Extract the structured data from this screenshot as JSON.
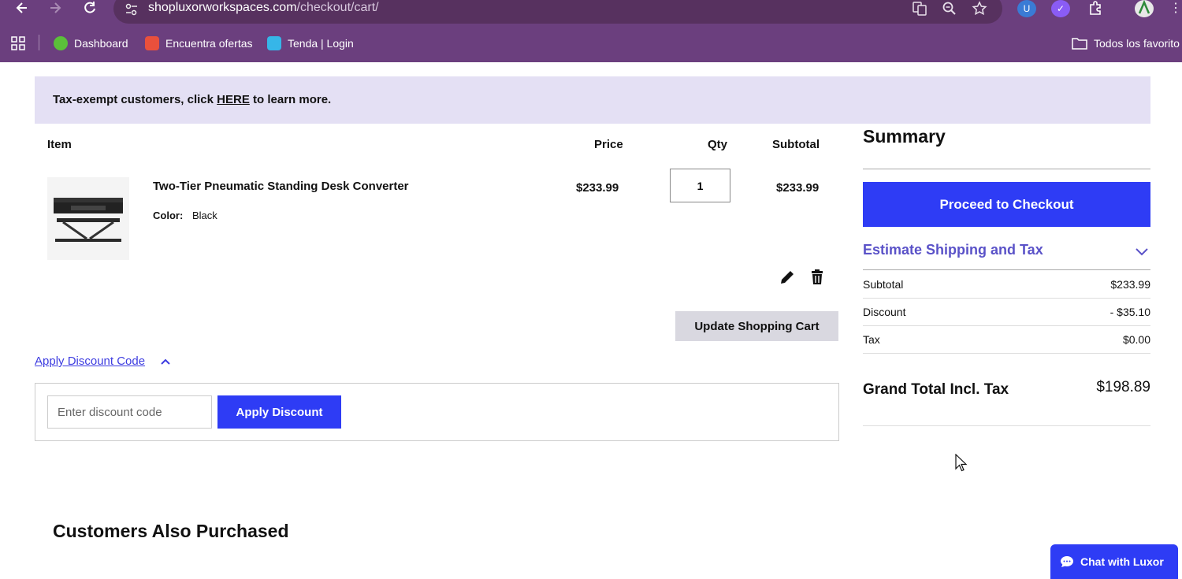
{
  "browser": {
    "url_host": "shopluxorworkspaces.com",
    "url_path": "/checkout/cart/",
    "bookmarks": [
      {
        "label": "Dashboard",
        "color": "#5bbf3a"
      },
      {
        "label": "Encuentra ofertas",
        "color": "#e9503c"
      },
      {
        "label": "Tenda | Login",
        "color": "#36b6e8"
      }
    ],
    "all_bookmarks_label": "Todos los favorito"
  },
  "banner": {
    "prefix": "Tax-exempt customers, click ",
    "link": "HERE",
    "suffix": " to learn more."
  },
  "cart": {
    "headers": {
      "item": "Item",
      "price": "Price",
      "qty": "Qty",
      "subtotal": "Subtotal"
    },
    "items": [
      {
        "name": "Two-Tier Pneumatic Standing Desk Converter",
        "color_label": "Color:",
        "color_value": "Black",
        "price": "$233.99",
        "qty": "1",
        "subtotal": "$233.99"
      }
    ],
    "update_label": "Update Shopping Cart"
  },
  "discount": {
    "toggle_label": "Apply Discount Code",
    "placeholder": "Enter discount code",
    "apply_label": "Apply Discount"
  },
  "summary": {
    "title": "Summary",
    "checkout_label": "Proceed to Checkout",
    "shipping_label": "Estimate Shipping and Tax",
    "rows": [
      {
        "label": "Subtotal",
        "value": "$233.99"
      },
      {
        "label": "Discount",
        "value": "- $35.10"
      },
      {
        "label": "Tax",
        "value": "$0.00"
      }
    ],
    "grand_total_label": "Grand Total Incl. Tax",
    "grand_total_value": "$198.89"
  },
  "also_purchased": {
    "heading": "Customers Also Purchased"
  },
  "chat": {
    "label": "Chat with Luxor"
  },
  "colors": {
    "accent": "#2e3cf5",
    "chrome": "#6b3f7e",
    "banner": "#e4e0f4",
    "link": "#5a52c8"
  }
}
